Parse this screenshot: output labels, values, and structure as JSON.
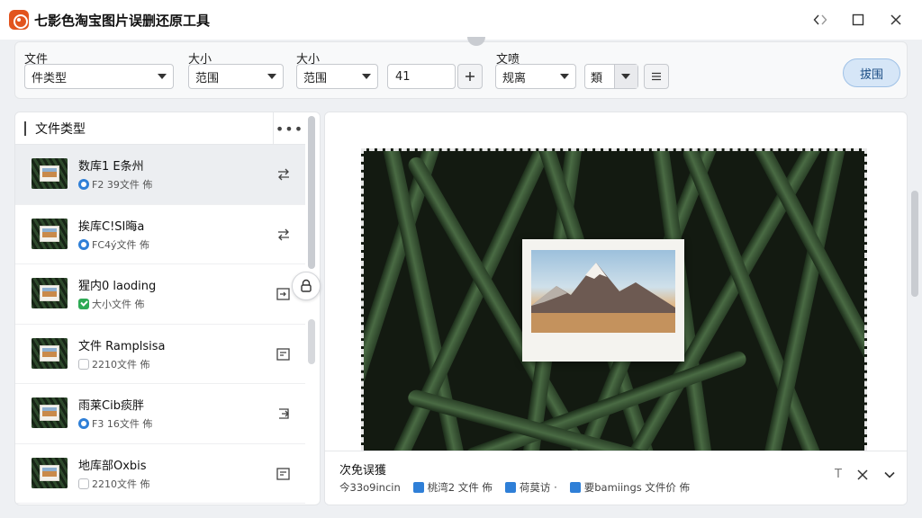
{
  "window": {
    "title": "七影色淘宝图片误删还原工具"
  },
  "toolbar": {
    "filter1": {
      "label": "文件",
      "value": "件类型"
    },
    "filter2": {
      "label": "大小",
      "value": "范围"
    },
    "filter3": {
      "label": "大小",
      "value": "范围"
    },
    "number_value": "41",
    "filter4": {
      "label": "文喷",
      "value": "规离"
    },
    "filter5": {
      "value": "類"
    },
    "primary_button": "拔围"
  },
  "sidebar": {
    "title": "文件类型",
    "more_label": "•••",
    "items": [
      {
        "name": "数库1 E条州",
        "meta": "F2 39文件 佈",
        "status_icon": "blue-drop-icon",
        "selected": true
      },
      {
        "name": "挨库C!SI晦a",
        "meta": "FC4ý文件 佈",
        "status_icon": "blue-disc-icon",
        "selected": false
      },
      {
        "name": "猩内0 laoding",
        "meta": "大小文件 佈",
        "status_icon": "green-check-icon",
        "selected": false
      },
      {
        "name": "文件 Ramplsisa",
        "meta": "2210文件 佈",
        "status_icon": "empty-box-icon",
        "selected": false
      },
      {
        "name": "雨莱Cib痰胖",
        "meta": "F3 16文件 佈",
        "status_icon": "blue-disc-icon",
        "selected": false
      },
      {
        "name": "地库部Oxbis",
        "meta": "2210文件 佈",
        "status_icon": "empty-box-icon",
        "selected": false
      }
    ]
  },
  "preview": {
    "title": "次免误獲",
    "meta_prefix": "今33ᴏ9incin",
    "chips": [
      {
        "label": "桃湾2 文件 佈",
        "icon": "image-icon"
      },
      {
        "label": "荷莫访 ·",
        "icon": "folder-icon"
      },
      {
        "label": "要bamiings 文件价 佈",
        "icon": "document-icon"
      }
    ],
    "tick_label": "T"
  },
  "colors": {
    "accent": "#2f7fd7",
    "logo": "#e2541e",
    "success": "#2eaa55",
    "primary_button_bg": "#d6e6f7"
  }
}
